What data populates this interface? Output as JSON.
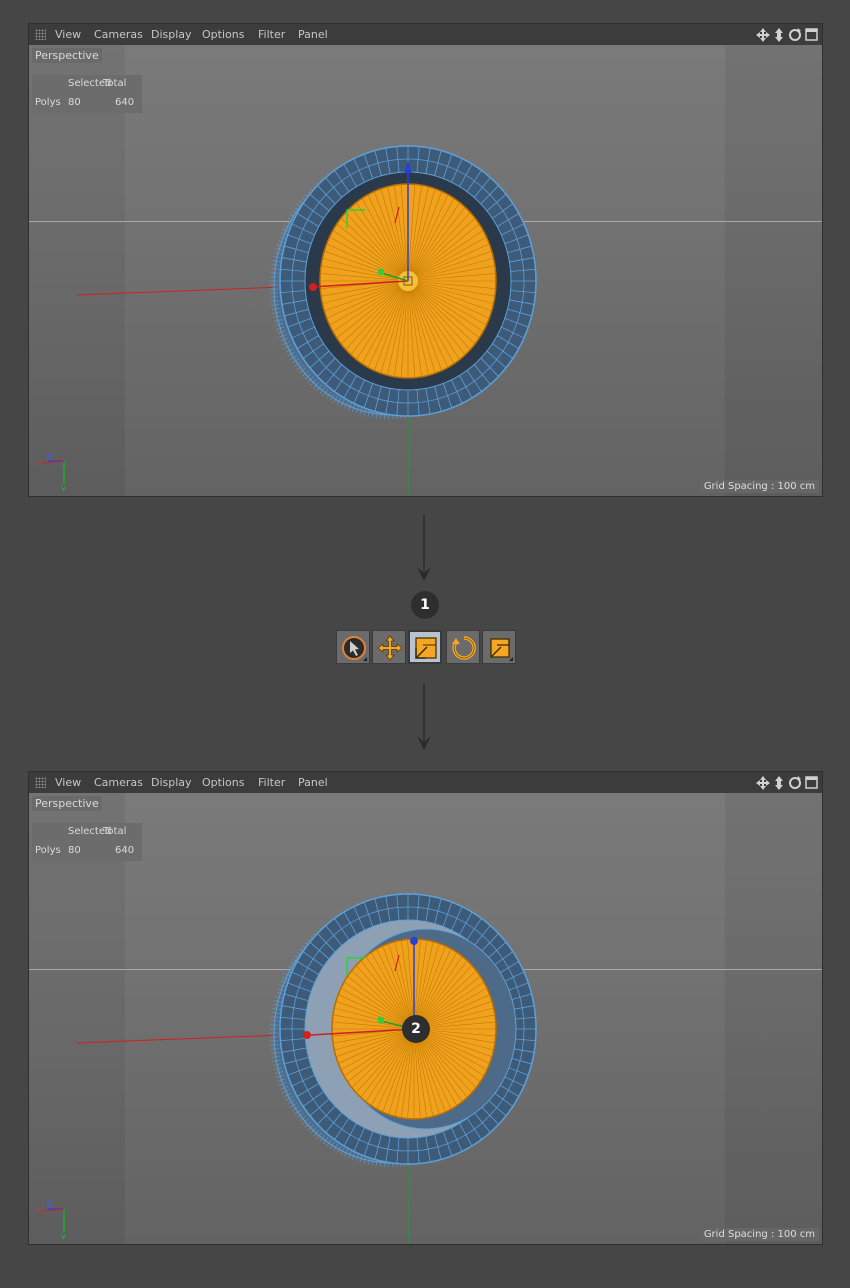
{
  "menu": [
    "View",
    "Cameras",
    "Display",
    "Options",
    "Filter",
    "Panel"
  ],
  "viewport_label": "Perspective",
  "stats": {
    "col_selected": "Selected",
    "col_total": "Total",
    "row_label": "Polys",
    "selected": "80",
    "total": "640"
  },
  "grid_spacing": "Grid Spacing : 100 cm",
  "axis_labels": {
    "y": "y",
    "z": "Z",
    "x": "x"
  },
  "steps": [
    "1",
    "2"
  ],
  "tools": [
    {
      "name": "live-selection",
      "active": false
    },
    {
      "name": "move",
      "active": false
    },
    {
      "name": "scale",
      "active": true
    },
    {
      "name": "rotate",
      "active": false
    },
    {
      "name": "scale-variant",
      "active": false
    }
  ],
  "colors": {
    "accent": "#f5a623",
    "mesh_blue": "#5da0d8",
    "selection_orange": "#f0a21e",
    "axis_x": "#d12020",
    "axis_y": "#1a9f2a",
    "axis_z": "#2a3fd6",
    "active_tool_bg": "#b8c3cf"
  }
}
